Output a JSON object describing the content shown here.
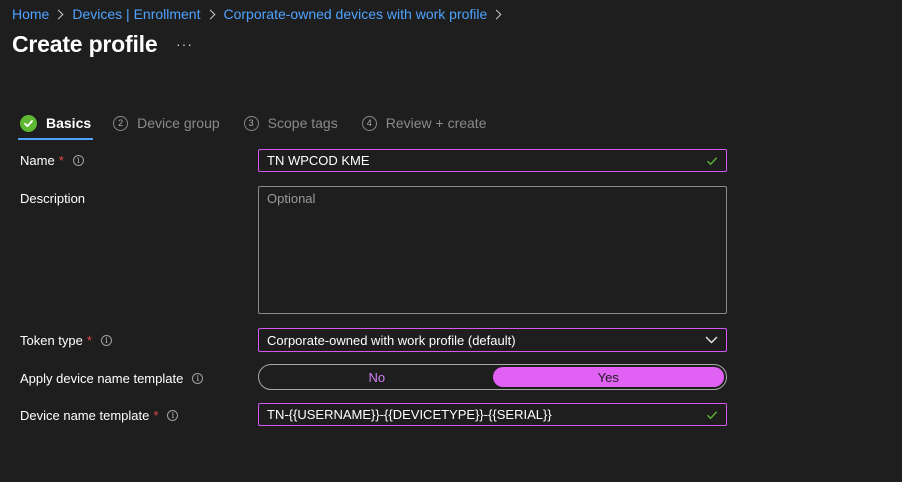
{
  "breadcrumb": {
    "items": [
      "Home",
      "Devices | Enrollment",
      "Corporate-owned devices with work profile"
    ]
  },
  "header": {
    "title": "Create profile",
    "more_label": "···"
  },
  "wizard": {
    "steps": [
      {
        "number": "1",
        "label": "Basics",
        "status": "completed",
        "active": true
      },
      {
        "number": "2",
        "label": "Device group"
      },
      {
        "number": "3",
        "label": "Scope tags"
      },
      {
        "number": "4",
        "label": "Review + create"
      }
    ]
  },
  "form": {
    "required_mark": "*",
    "info_glyph": "i",
    "name": {
      "label": "Name",
      "value": "TN WPCOD KME"
    },
    "description": {
      "label": "Description",
      "placeholder": "Optional",
      "value": ""
    },
    "token_type": {
      "label": "Token type",
      "selected": "Corporate-owned with work profile (default)"
    },
    "apply_template": {
      "label": "Apply device name template",
      "options": [
        "No",
        "Yes"
      ],
      "selected": "Yes"
    },
    "device_name_template": {
      "label": "Device name template",
      "value": "TN-{{USERNAME}}-{{DEVICETYPE}}-{{SERIAL}}"
    }
  },
  "colors": {
    "background": "#1e1e1e",
    "link": "#4fa3ff",
    "accent": "#e161f4",
    "success": "#5fb832",
    "required": "#e0494d"
  },
  "icons": {
    "validation": "check-icon",
    "dropdown": "chevron-down-icon",
    "info": "info-icon",
    "breadcrumb_separator": "chevron-right-icon"
  }
}
